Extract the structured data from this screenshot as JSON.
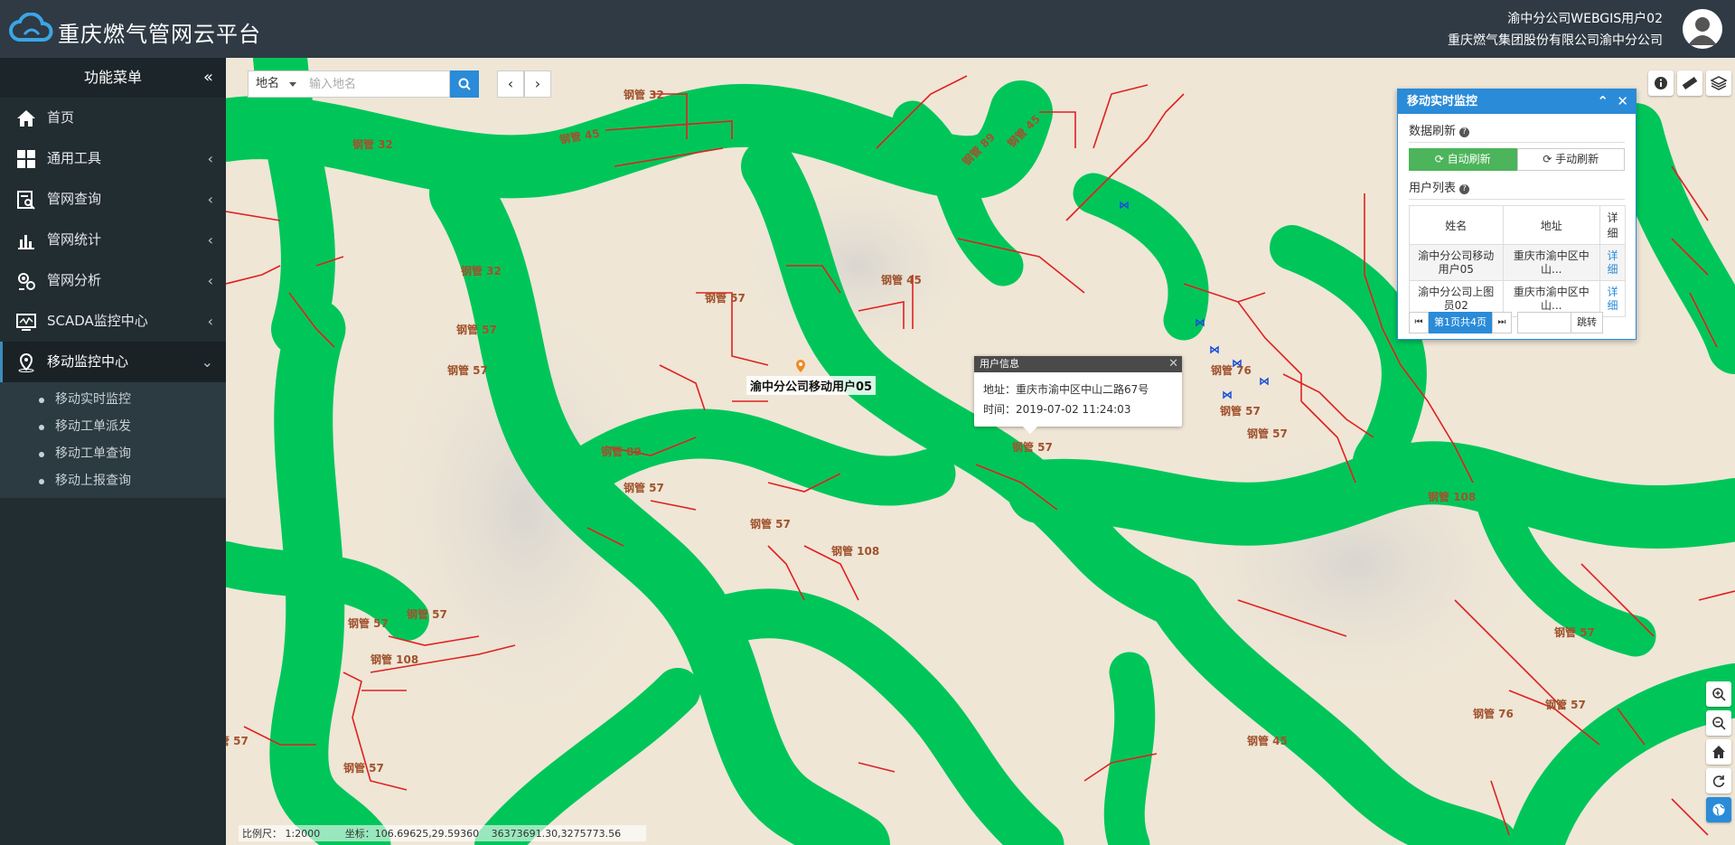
{
  "header": {
    "title": "重庆燃气管网云平台",
    "user_name": "渝中分公司WEBGIS用户02",
    "company": "重庆燃气集团股份有限公司渝中分公司"
  },
  "sidebar": {
    "title": "功能菜单",
    "items": [
      {
        "label": "首页",
        "icon": "home-icon",
        "has_arrow": false
      },
      {
        "label": "通用工具",
        "icon": "grid-icon",
        "has_arrow": true
      },
      {
        "label": "管网查询",
        "icon": "query-icon",
        "has_arrow": true
      },
      {
        "label": "管网统计",
        "icon": "chart-icon",
        "has_arrow": true
      },
      {
        "label": "管网分析",
        "icon": "analysis-icon",
        "has_arrow": true
      },
      {
        "label": "SCADA监控中心",
        "icon": "monitor-icon",
        "has_arrow": true
      },
      {
        "label": "移动监控中心",
        "icon": "location-icon",
        "has_arrow": true,
        "expanded": true
      }
    ],
    "subitems": [
      "移动实时监控",
      "移动工单派发",
      "移动工单查询",
      "移动上报查询"
    ]
  },
  "search": {
    "type": "地名",
    "placeholder": "输入地名"
  },
  "popup": {
    "title": "用户信息",
    "address": "地址：重庆市渝中区中山二路67号",
    "time": "时间：2019-07-02 11:24:03"
  },
  "marker_label": "渝中分公司移动用户05",
  "monitor": {
    "title": "移动实时监控",
    "data_refresh": "数据刷新",
    "auto_refresh": "自动刷新",
    "manual_refresh": "手动刷新",
    "user_list": "用户列表",
    "columns": [
      "姓名",
      "地址",
      "详细"
    ],
    "rows": [
      {
        "name": "渝中分公司移动用户05",
        "address": "重庆市渝中区中山...",
        "detail": "详细"
      },
      {
        "name": "渝中分公司上图员02",
        "address": "重庆市渝中区中山...",
        "detail": "详细"
      }
    ],
    "page_info": "第1页共4页",
    "jump": "跳转"
  },
  "status": {
    "scale": "比例尺： 1:2000",
    "coords": "坐标：106.69625,29.59360",
    "projected": "36373691.30,3275773.56"
  },
  "pipe_labels": [
    "钢管 32",
    "钢管 45",
    "钢管 89",
    "钢管 57",
    "钢管 108",
    "钢管 76"
  ],
  "colors": {
    "header_bg": "#2f3a44",
    "sidebar_bg": "#222d32",
    "accent": "#2a8bd8",
    "auto_refresh": "#4cb45a",
    "green_area": "#00c65a",
    "pipe": "#e02020"
  }
}
